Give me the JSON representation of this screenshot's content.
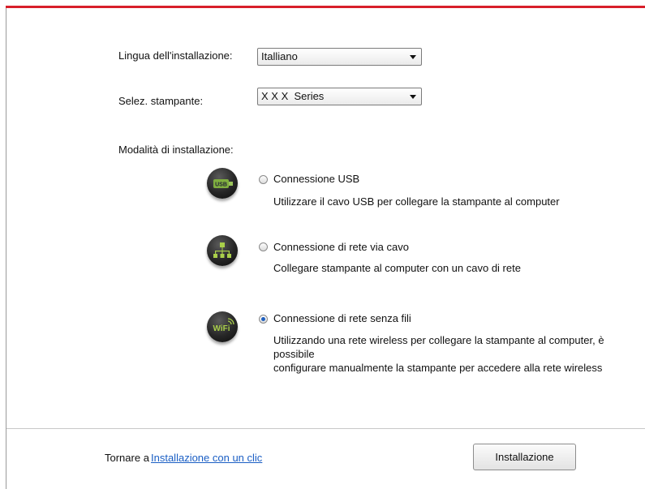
{
  "settings": {
    "language_label": "Lingua dell'installazione:",
    "language_value": "Italliano",
    "printer_label": "Selez. stampante:",
    "printer_value": "X X X  Series",
    "mode_label": "Modalità di installazione:"
  },
  "options": [
    {
      "icon": "usb-icon",
      "icon_text": "USB",
      "title": "Connessione USB",
      "description": "Utilizzare il cavo USB per collegare la stampante al computer",
      "selected": false
    },
    {
      "icon": "wired-network-icon",
      "title": "Connessione di rete via cavo",
      "description": "Collegare stampante al computer con un cavo di rete",
      "selected": false
    },
    {
      "icon": "wifi-icon",
      "icon_text": "WiFi",
      "title": "Connessione di rete senza fili",
      "description_line1": "Utilizzando una rete wireless per collegare la stampante al computer, è possibile",
      "description_line2": "configurare manualmente la stampante per accedere alla rete wireless",
      "selected": true
    }
  ],
  "footer": {
    "return_text": "Tornare a",
    "link_text": "Installazione con un clic",
    "install_button": "Installazione"
  },
  "colors": {
    "accent_bar": "#d81f2a",
    "link": "#1a5ec4",
    "radio_selected": "#1f5fbf"
  }
}
